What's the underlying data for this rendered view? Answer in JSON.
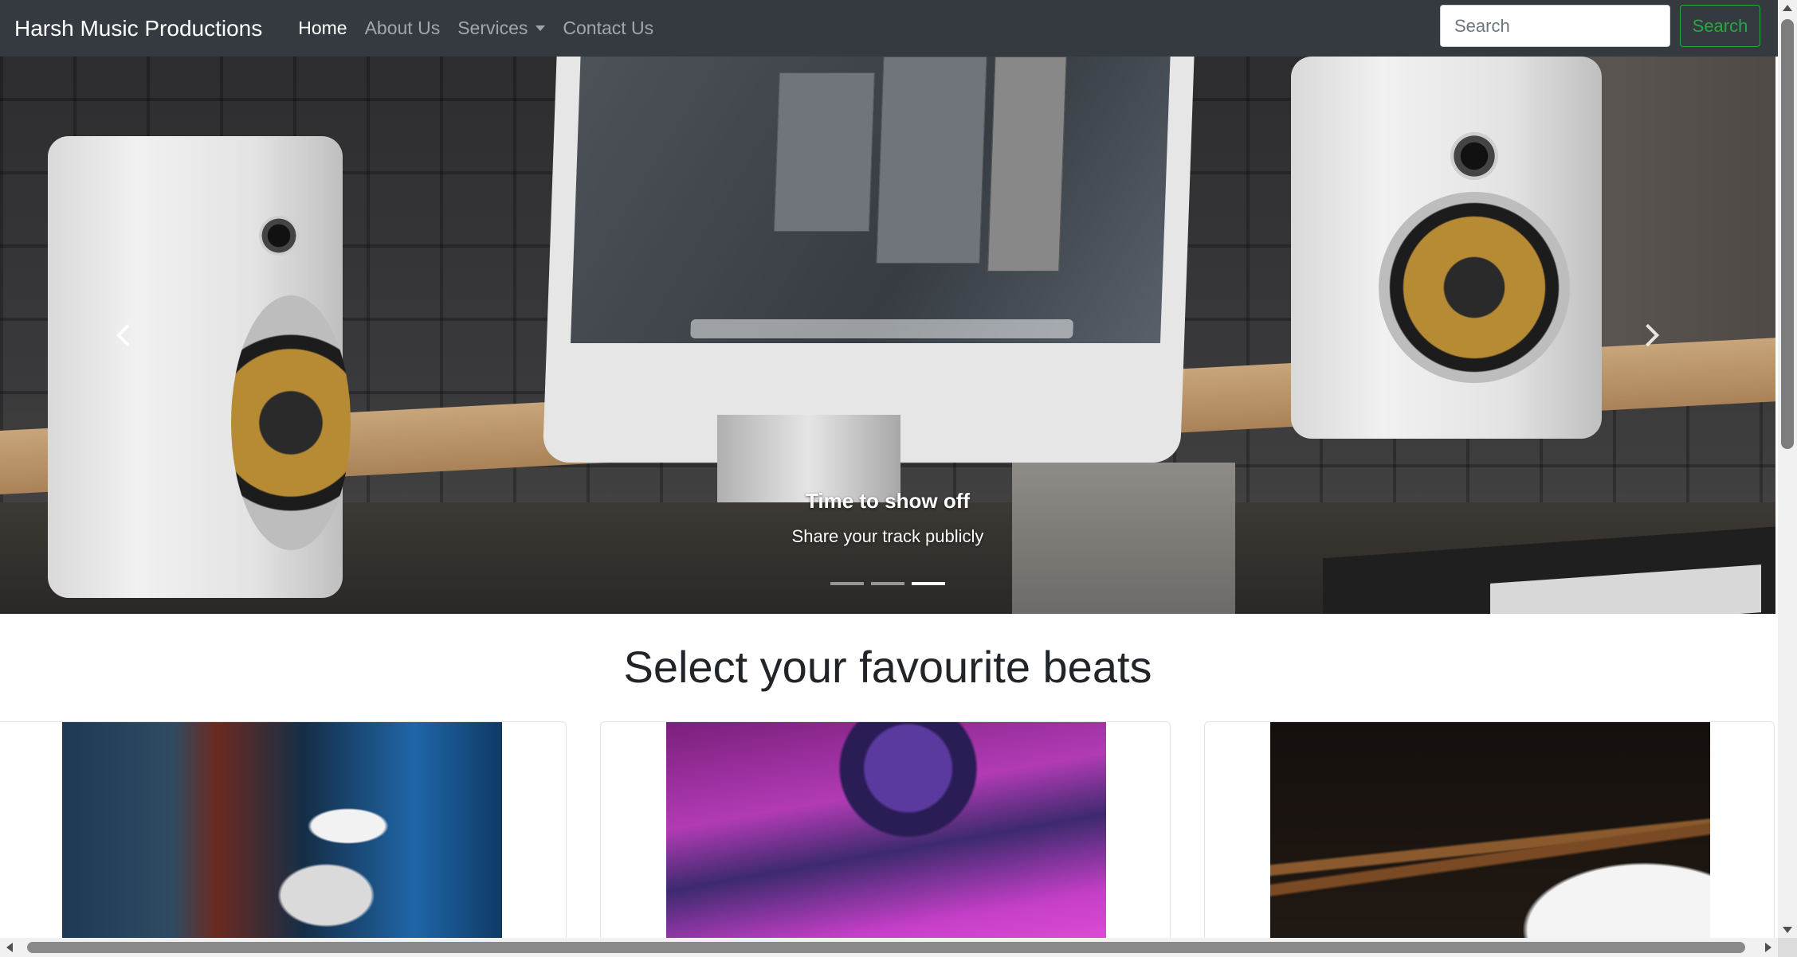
{
  "navbar": {
    "brand": "Harsh Music Productions",
    "links": [
      {
        "label": "Home",
        "active": true
      },
      {
        "label": "About Us",
        "active": false
      },
      {
        "label": "Services",
        "active": false,
        "dropdown": true
      },
      {
        "label": "Contact Us",
        "active": false
      }
    ],
    "search": {
      "placeholder": "Search",
      "button_label": "Search"
    }
  },
  "carousel": {
    "caption_title": "Time to show off",
    "caption_text": "Share your track publicly",
    "slide_count": 3,
    "active_slide": 3,
    "prev_icon": "chevron-left-icon",
    "next_icon": "chevron-right-icon"
  },
  "beats_section": {
    "title": "Select your favourite beats",
    "cards": [
      {
        "image": "dj-girl-headphones"
      },
      {
        "image": "purple-synth-mixer"
      },
      {
        "image": "drumsticks-snare"
      }
    ]
  },
  "colors": {
    "navbar_bg": "#343a40",
    "search_button": "#28a745"
  }
}
